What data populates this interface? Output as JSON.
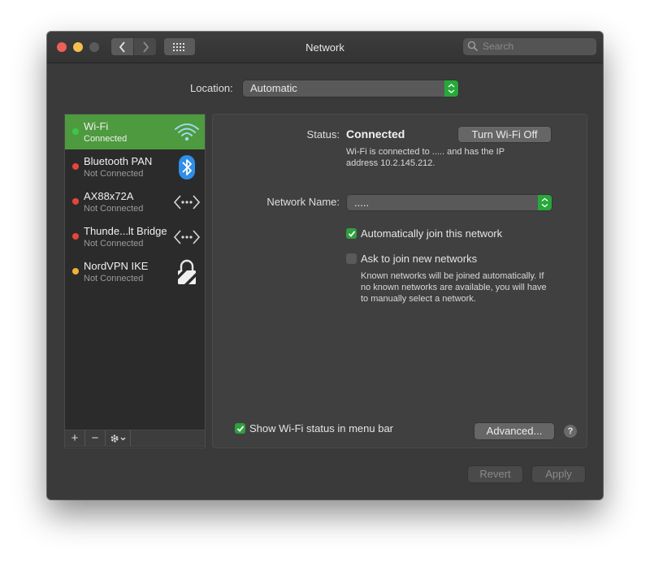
{
  "window": {
    "title": "Network"
  },
  "search": {
    "placeholder": "Search"
  },
  "location": {
    "label": "Location:",
    "value": "Automatic"
  },
  "services": [
    {
      "name": "Wi-Fi",
      "status": "Connected",
      "dot_color": "#3cc64b",
      "icon": "wifi-icon"
    },
    {
      "name": "Bluetooth PAN",
      "status": "Not Connected",
      "dot_color": "#e8443a",
      "icon": "bluetooth-icon"
    },
    {
      "name": "AX88x72A",
      "status": "Not Connected",
      "dot_color": "#e8443a",
      "icon": "ethernet-icon"
    },
    {
      "name": "Thunde...lt Bridge",
      "status": "Not Connected",
      "dot_color": "#e8443a",
      "icon": "ethernet-icon"
    },
    {
      "name": "NordVPN IKE",
      "status": "Not Connected",
      "dot_color": "#f2b233",
      "icon": "lock-icon"
    }
  ],
  "sidebar_toolbar": {
    "add": "+",
    "remove": "−"
  },
  "detail": {
    "status_label": "Status:",
    "status_value": "Connected",
    "turn_off_button": "Turn Wi-Fi Off",
    "status_desc_line1": "Wi-Fi is connected to ..... and has the IP",
    "status_desc_line2": "address 10.2.145.212.",
    "network_name_label": "Network Name:",
    "network_name_value": ".....",
    "auto_join_label": "Automatically join this network",
    "auto_join_checked": true,
    "ask_join_label": "Ask to join new networks",
    "ask_join_checked": false,
    "ask_desc_line1": "Known networks will be joined automatically. If",
    "ask_desc_line2": "no known networks are available, you will have",
    "ask_desc_line3": "to manually select a network.",
    "show_status_label": "Show Wi-Fi status in menu bar",
    "show_status_checked": true,
    "advanced_button": "Advanced...",
    "help_button": "?"
  },
  "footer": {
    "revert_button": "Revert",
    "apply_button": "Apply"
  },
  "colors": {
    "accent_green": "#2f9f3f",
    "selected_row": "#4e9a3e"
  }
}
